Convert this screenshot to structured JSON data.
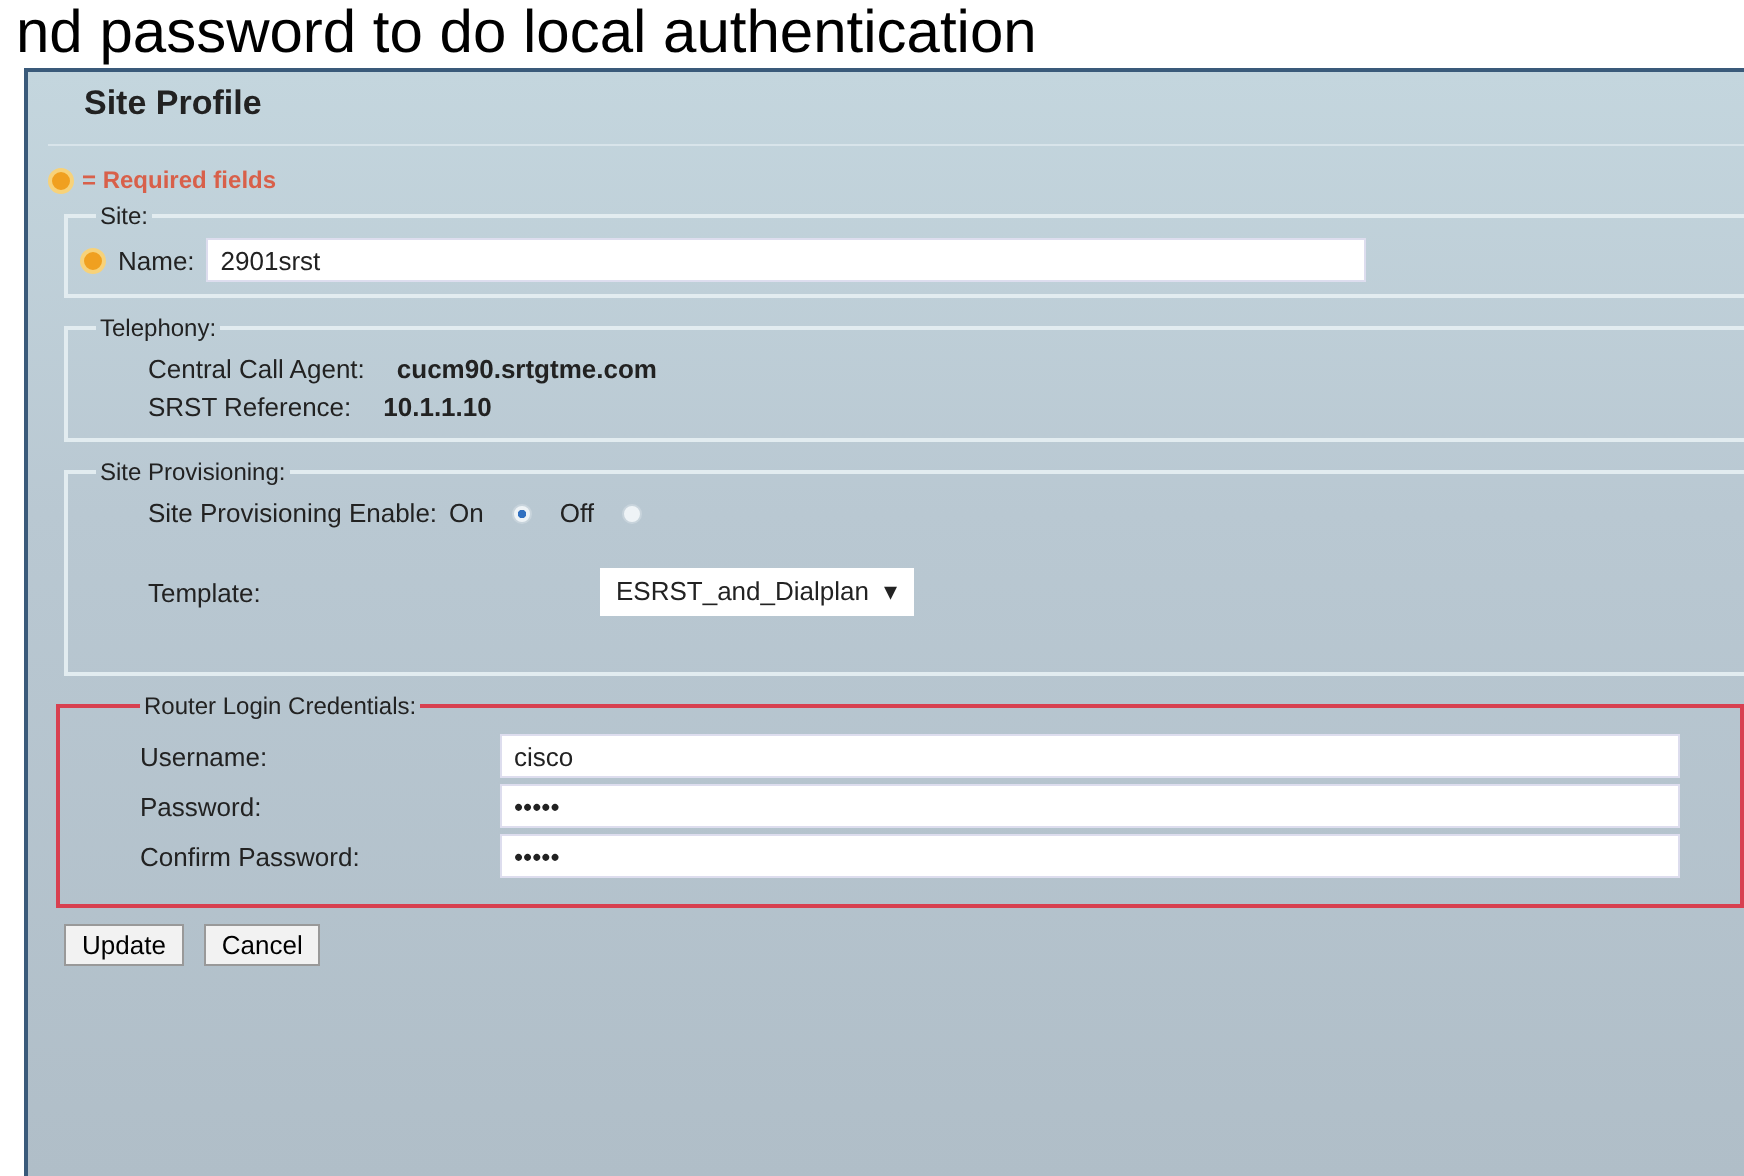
{
  "caption": "nd password to do local authentication",
  "window": {
    "title": "Site Profile"
  },
  "required_note": "= Required fields",
  "site": {
    "legend": "Site:",
    "name_label": "Name:",
    "name_value": "2901srst",
    "required": true
  },
  "telephony": {
    "legend": "Telephony:",
    "rows": [
      {
        "label": "Central Call Agent:",
        "value": "cucm90.srtgtme.com"
      },
      {
        "label": "SRST Reference:",
        "value": "10.1.1.10"
      }
    ]
  },
  "provisioning": {
    "legend": "Site Provisioning:",
    "enable_label": "Site Provisioning Enable:",
    "options": [
      {
        "label": "On",
        "selected": true
      },
      {
        "label": "Off",
        "selected": false
      }
    ],
    "template_label": "Template:",
    "template_value": "ESRST_and_Dialplan",
    "template_caret": "▾"
  },
  "credentials": {
    "legend": "Router Login Credentials:",
    "highlighted": true,
    "fields": [
      {
        "label": "Username:",
        "value": "cisco"
      },
      {
        "label": "Password:",
        "value": "•••••"
      },
      {
        "label": "Confirm Password:",
        "value": "•••••"
      }
    ]
  },
  "buttons": [
    "Update",
    "Cancel"
  ]
}
